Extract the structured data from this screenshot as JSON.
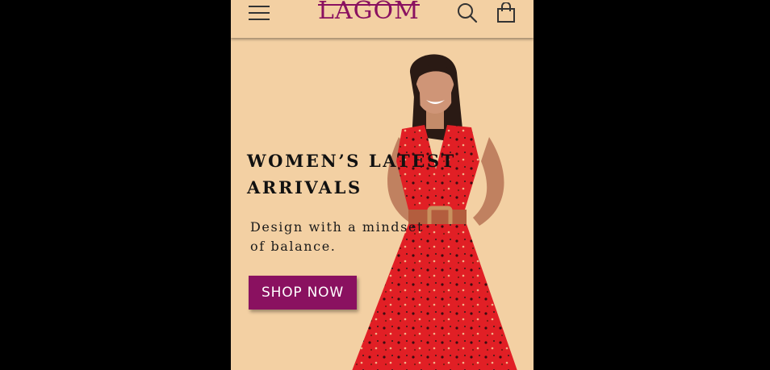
{
  "header": {
    "logo_text": "LAGOM",
    "menu_icon": "hamburger-menu-icon",
    "search_icon": "search-icon",
    "bag_icon": "shopping-bag-icon"
  },
  "hero": {
    "headline_line1": "WOMEN’S LATEST",
    "headline_line2": "ARRIVALS",
    "tagline_line1": "Design with a mindset",
    "tagline_line2": "of balance.",
    "cta_label": "SHOP NOW",
    "image": "woman-in-red-floral-dress"
  },
  "colors": {
    "background": "#f3d0a3",
    "brand": "#8a1160",
    "page_outside": "#000000"
  }
}
